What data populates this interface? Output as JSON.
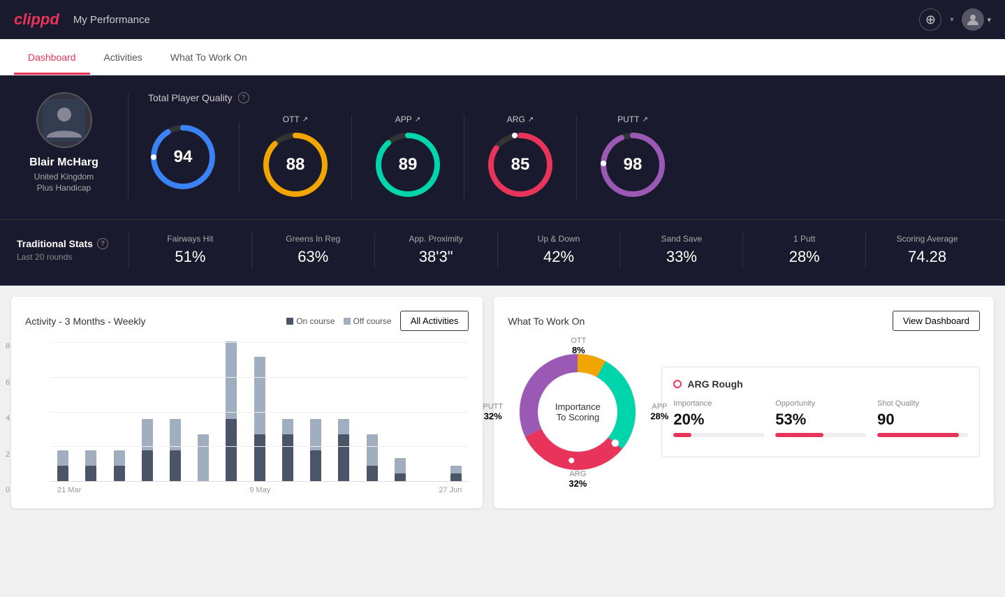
{
  "header": {
    "logo": "clippd",
    "logo_clip": "clip",
    "logo_pd": "pd",
    "title": "My Performance",
    "add_btn_label": "+",
    "chevron": "▾"
  },
  "nav": {
    "tabs": [
      {
        "id": "dashboard",
        "label": "Dashboard",
        "active": true
      },
      {
        "id": "activities",
        "label": "Activities",
        "active": false
      },
      {
        "id": "what-to-work-on",
        "label": "What To Work On",
        "active": false
      }
    ]
  },
  "player": {
    "name": "Blair McHarg",
    "country": "United Kingdom",
    "handicap": "Plus Handicap"
  },
  "quality": {
    "title": "Total Player Quality",
    "main_score": 94,
    "gauges": [
      {
        "label": "OTT",
        "value": 88,
        "color": "#f0a500",
        "track": "#333"
      },
      {
        "label": "APP",
        "value": 89,
        "color": "#00d4aa",
        "track": "#333"
      },
      {
        "label": "ARG",
        "value": 85,
        "color": "#e8345a",
        "track": "#333"
      },
      {
        "label": "PUTT",
        "value": 98,
        "color": "#9b59b6",
        "track": "#333"
      }
    ]
  },
  "stats": {
    "title": "Traditional Stats",
    "subtitle": "Last 20 rounds",
    "items": [
      {
        "label": "Fairways Hit",
        "value": "51%"
      },
      {
        "label": "Greens In Reg",
        "value": "63%"
      },
      {
        "label": "App. Proximity",
        "value": "38'3\""
      },
      {
        "label": "Up & Down",
        "value": "42%"
      },
      {
        "label": "Sand Save",
        "value": "33%"
      },
      {
        "label": "1 Putt",
        "value": "28%"
      },
      {
        "label": "Scoring Average",
        "value": "74.28"
      }
    ]
  },
  "activity_chart": {
    "title": "Activity - 3 Months - Weekly",
    "legend": [
      {
        "label": "On course",
        "color": "#4a5568"
      },
      {
        "label": "Off course",
        "color": "#a0aec0"
      }
    ],
    "all_activities_label": "All Activities",
    "x_labels": [
      "21 Mar",
      "9 May",
      "27 Jun"
    ],
    "y_labels": [
      "8",
      "6",
      "4",
      "2",
      "0"
    ],
    "bars": [
      {
        "on": 1,
        "off": 1
      },
      {
        "on": 1,
        "off": 1
      },
      {
        "on": 1,
        "off": 1
      },
      {
        "on": 2,
        "off": 2
      },
      {
        "on": 2,
        "off": 2
      },
      {
        "on": 0,
        "off": 3
      },
      {
        "on": 4,
        "off": 5
      },
      {
        "on": 3,
        "off": 5
      },
      {
        "on": 3,
        "off": 1
      },
      {
        "on": 2,
        "off": 2
      },
      {
        "on": 3,
        "off": 1
      },
      {
        "on": 1,
        "off": 2
      },
      {
        "on": 0.5,
        "off": 1
      },
      {
        "on": 0,
        "off": 0
      },
      {
        "on": 0.5,
        "off": 0.5
      }
    ]
  },
  "what_to_work_on": {
    "title": "What To Work On",
    "view_dashboard_label": "View Dashboard",
    "donut_center": [
      "Importance",
      "To Scoring"
    ],
    "segments": [
      {
        "label": "OTT",
        "pct": "8%",
        "color": "#f0a500",
        "value": 8
      },
      {
        "label": "APP",
        "pct": "28%",
        "color": "#00d4aa",
        "value": 28
      },
      {
        "label": "ARG",
        "pct": "32%",
        "color": "#e8345a",
        "value": 32
      },
      {
        "label": "PUTT",
        "pct": "32%",
        "color": "#9b59b6",
        "value": 32
      }
    ],
    "selected": {
      "title": "ARG Rough",
      "dot_color": "#e8345a",
      "metrics": [
        {
          "label": "Importance",
          "value": "20%",
          "fill_pct": 20,
          "color": "#e8345a"
        },
        {
          "label": "Opportunity",
          "value": "53%",
          "fill_pct": 53,
          "color": "#e8345a"
        },
        {
          "label": "Shot Quality",
          "value": "90",
          "fill_pct": 90,
          "color": "#e8345a"
        }
      ]
    }
  }
}
